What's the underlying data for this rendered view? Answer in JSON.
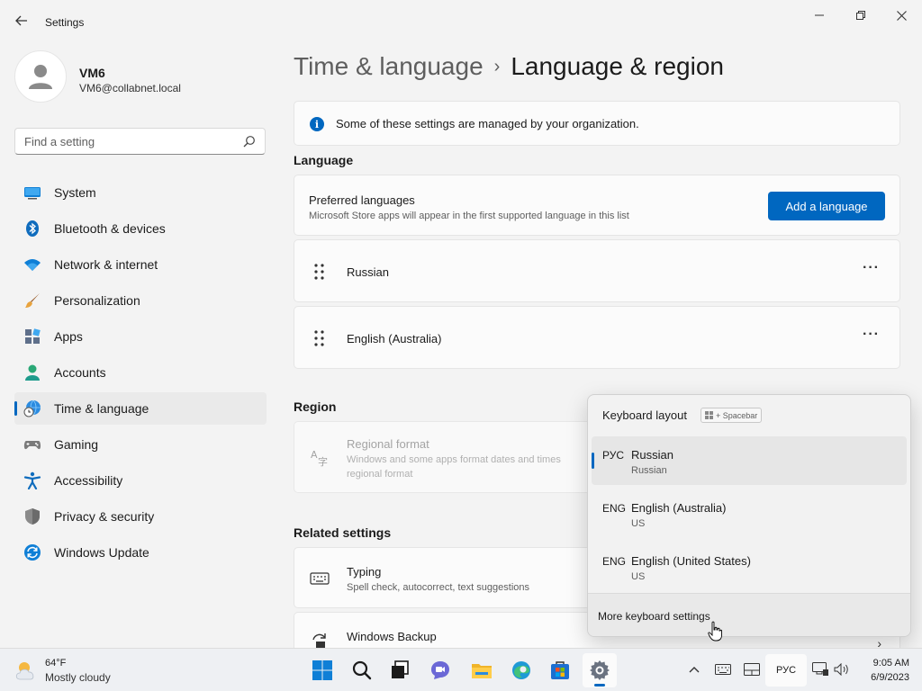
{
  "window": {
    "title": "Settings"
  },
  "profile": {
    "name": "VM6",
    "email": "VM6@collabnet.local"
  },
  "search": {
    "placeholder": "Find a setting"
  },
  "nav": {
    "items": [
      {
        "label": "System",
        "icon": "system-icon"
      },
      {
        "label": "Bluetooth & devices",
        "icon": "bluetooth-icon"
      },
      {
        "label": "Network & internet",
        "icon": "wifi-icon"
      },
      {
        "label": "Personalization",
        "icon": "brush-icon"
      },
      {
        "label": "Apps",
        "icon": "apps-icon"
      },
      {
        "label": "Accounts",
        "icon": "accounts-icon"
      },
      {
        "label": "Time & language",
        "icon": "globe-clock-icon",
        "active": true
      },
      {
        "label": "Gaming",
        "icon": "gamepad-icon"
      },
      {
        "label": "Accessibility",
        "icon": "accessibility-icon"
      },
      {
        "label": "Privacy & security",
        "icon": "shield-icon"
      },
      {
        "label": "Windows Update",
        "icon": "update-icon"
      }
    ]
  },
  "breadcrumb": {
    "parent": "Time & language",
    "separator": "›",
    "current": "Language & region"
  },
  "info_banner": {
    "text": "Some of these settings are managed by your organization."
  },
  "language": {
    "section_title": "Language",
    "preferred_title": "Preferred languages",
    "preferred_sub": "Microsoft Store apps will appear in the first supported language in this list",
    "add_button": "Add a language",
    "languages": [
      "Russian",
      "English (Australia)"
    ]
  },
  "region": {
    "section_title": "Region",
    "format_title": "Regional format",
    "format_sub_line1": "Windows and some apps format dates and times",
    "format_sub_line2": "regional format"
  },
  "related": {
    "section_title": "Related settings",
    "typing_title": "Typing",
    "typing_sub": "Spell check, autocorrect, text suggestions",
    "backup_title": "Windows Backup"
  },
  "keyboard_flyout": {
    "title": "Keyboard layout",
    "shortcut_hint": "+ Spacebar",
    "items": [
      {
        "code": "РУС",
        "name": "Russian",
        "sub": "Russian",
        "active": true
      },
      {
        "code": "ENG",
        "name": "English (Australia)",
        "sub": "US"
      },
      {
        "code": "ENG",
        "name": "English (United States)",
        "sub": "US"
      }
    ],
    "footer": "More keyboard settings"
  },
  "taskbar": {
    "weather_temp": "64°F",
    "weather_cond": "Mostly cloudy",
    "lang_indicator": "РУС",
    "time": "9:05 AM",
    "date": "6/9/2023"
  },
  "colors": {
    "accent": "#0067c0",
    "background": "#f3f3f3",
    "card": "#fbfbfb"
  }
}
